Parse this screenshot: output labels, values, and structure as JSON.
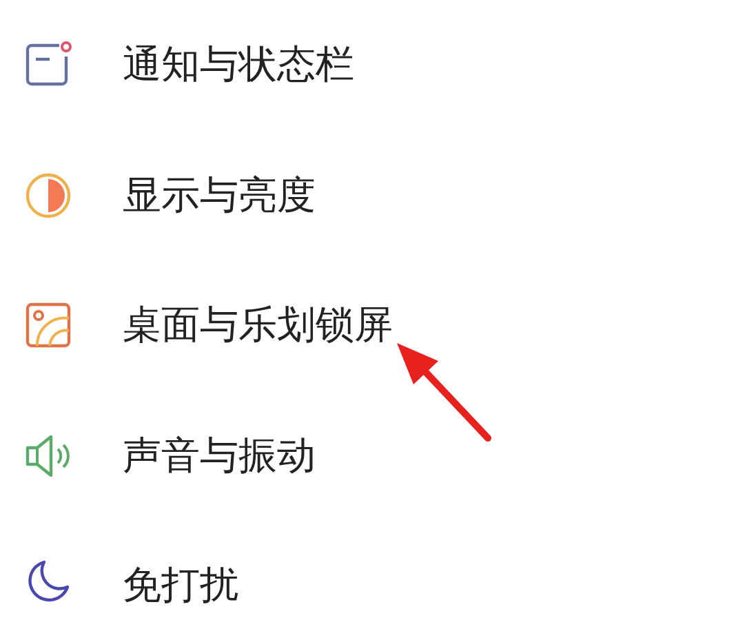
{
  "settings_items": [
    {
      "label": "通知与状态栏",
      "kind": "notification"
    },
    {
      "label": "显示与亮度",
      "kind": "display"
    },
    {
      "label": "桌面与乐划锁屏",
      "kind": "wallpaper"
    },
    {
      "label": "声音与振动",
      "kind": "sound"
    },
    {
      "label": "免打扰",
      "kind": "moon"
    }
  ]
}
